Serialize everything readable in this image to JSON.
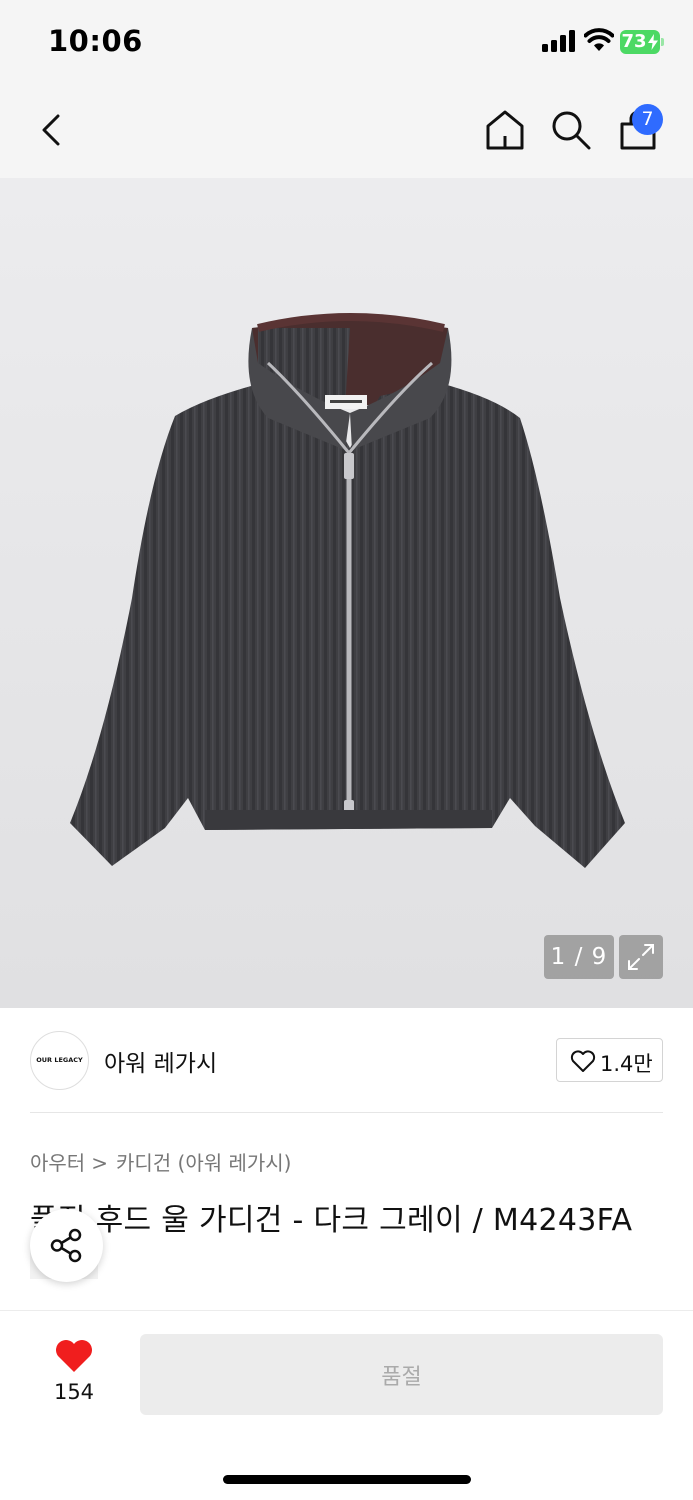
{
  "status_bar": {
    "time": "10:06",
    "battery": "73",
    "icons": [
      "signal-icon",
      "wifi-icon",
      "battery-icon"
    ]
  },
  "nav": {
    "icons": [
      "back-arrow-icon",
      "home-icon",
      "search-icon",
      "shopping-bag-icon"
    ],
    "cart_badge": "7",
    "accent_color": "#2f6bff"
  },
  "gallery": {
    "counter": "1 / 9",
    "icons": [
      "expand-icon"
    ]
  },
  "brand": {
    "logo_text": "OUR LEGACY",
    "name": "아워 레가시",
    "like_count": "1.4만"
  },
  "breadcrumb": {
    "category": "아우터",
    "separator": ">",
    "subcategory": "카디건 (아워 레가시)"
  },
  "product": {
    "title": "풀짚 후드 울 가디건 - 다크 그레이 / M4243FA"
  },
  "bottom_bar": {
    "wish_count": "154",
    "wish_color": "#f01e1e",
    "soldout_label": "품절"
  }
}
